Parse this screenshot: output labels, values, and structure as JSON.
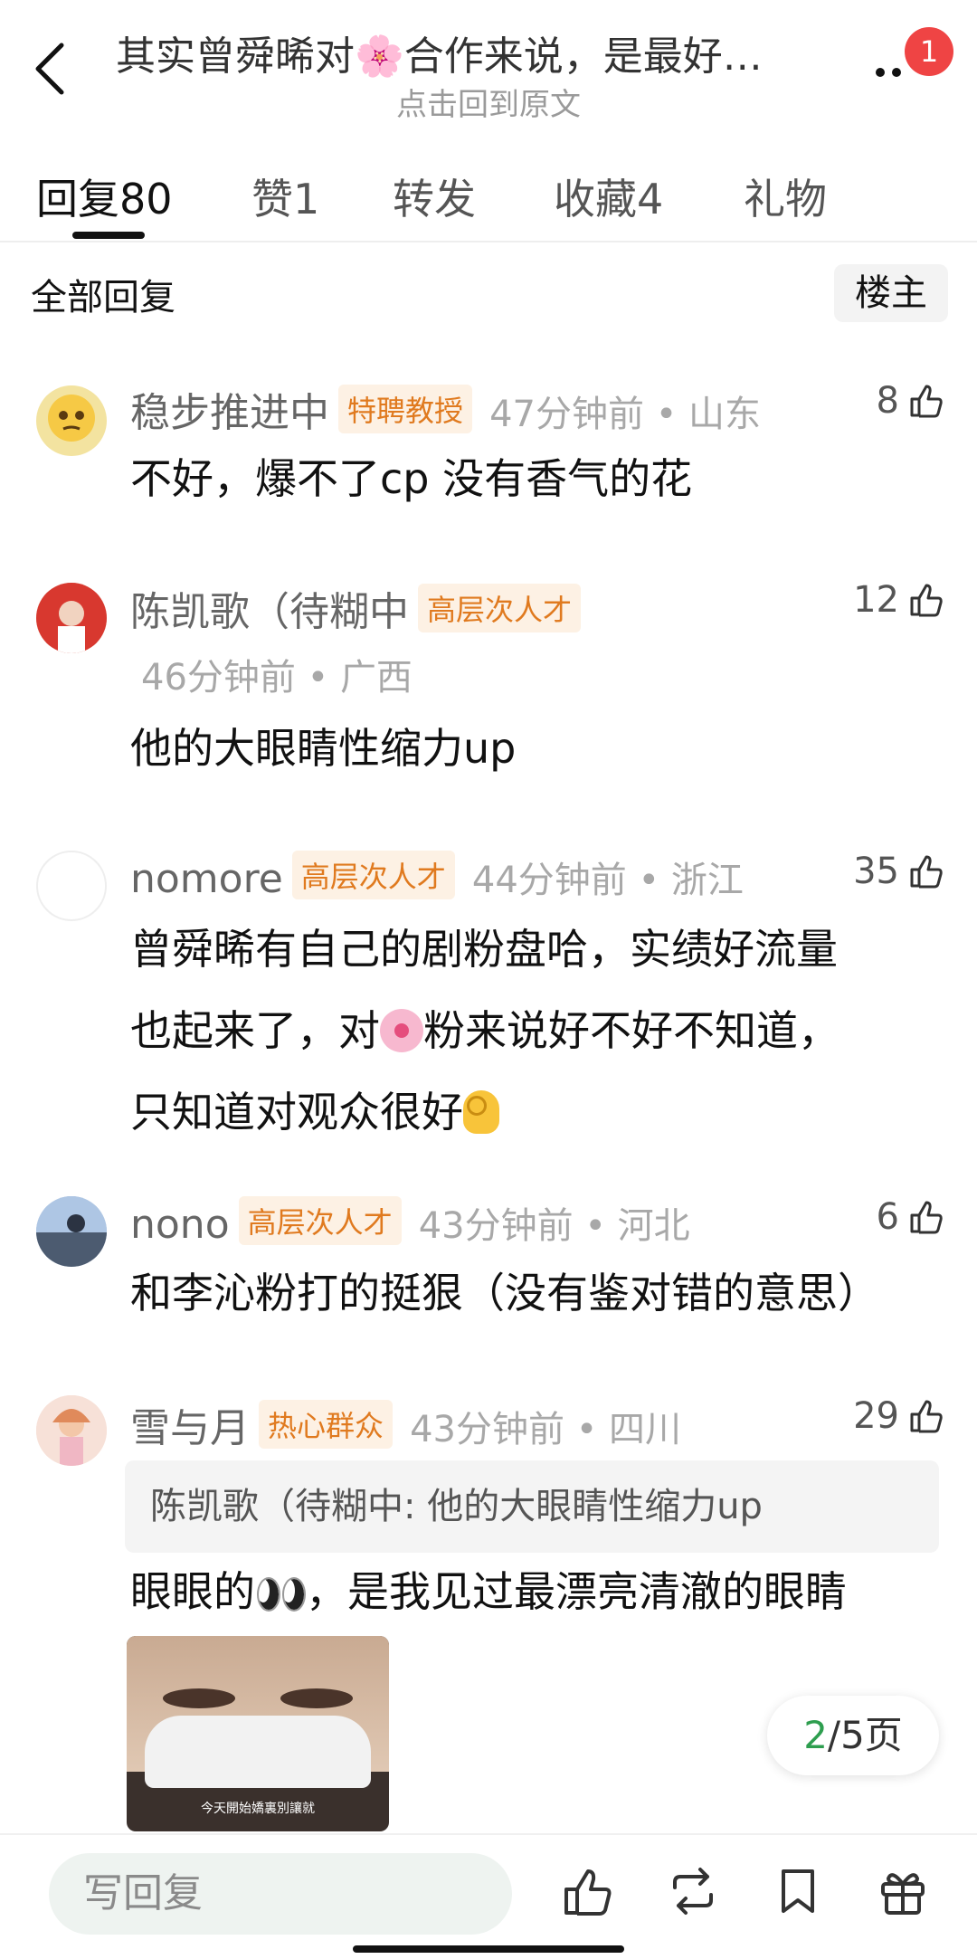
{
  "header": {
    "title": "其实曾舜晞对🌸合作来说，是最好…",
    "subtitle": "点击回到原文",
    "notification_count": "1"
  },
  "tabs": [
    {
      "label": "回复80"
    },
    {
      "label": "赞1"
    },
    {
      "label": "转发"
    },
    {
      "label": "收藏4"
    },
    {
      "label": "礼物"
    }
  ],
  "section": {
    "title": "全部回复",
    "owner_filter": "楼主"
  },
  "comments": [
    {
      "name": "稳步推进中",
      "tag": "特聘教授",
      "time": "47分钟前",
      "location": "山东",
      "likes": "8",
      "text": "不好，爆不了cp 没有香气的花"
    },
    {
      "name": "陈凯歌（待糊中",
      "tag": "高层次人才",
      "time": "46分钟前",
      "location": "广西",
      "likes": "12",
      "text": "他的大眼睛性缩力up"
    },
    {
      "name": "nomore",
      "tag": "高层次人才",
      "time": "44分钟前",
      "location": "浙江",
      "likes": "35",
      "text_line1": "曾舜晞有自己的剧粉盘哈，实绩好流量",
      "text_line2a": "也起来了，对",
      "text_line2b": "粉来说好不好不知道，",
      "text_line3": "只知道对观众很好"
    },
    {
      "name": "nono",
      "tag": "高层次人才",
      "time": "43分钟前",
      "location": "河北",
      "likes": "6",
      "text": "和李沁粉打的挺狠（没有鉴对错的意思）"
    },
    {
      "name": "雪与月",
      "tag": "热心群众",
      "time": "43分钟前",
      "location": "四川",
      "likes": "29",
      "quote": "陈凯歌（待糊中: 他的大眼睛性缩力up",
      "text_a": "眼眼的",
      "text_b": "，是我见过最漂亮清澈的眼睛",
      "image_caption": "今天開始嬌裏別讓就"
    }
  ],
  "pager": {
    "current": "2",
    "total": "/5页"
  },
  "bottom": {
    "reply_placeholder": "写回复"
  },
  "colors": {
    "tag_text": "#e07a1f",
    "tag_bg": "#fdf1e4",
    "badge": "#ef4444",
    "pager_current": "#2e9e4f"
  }
}
